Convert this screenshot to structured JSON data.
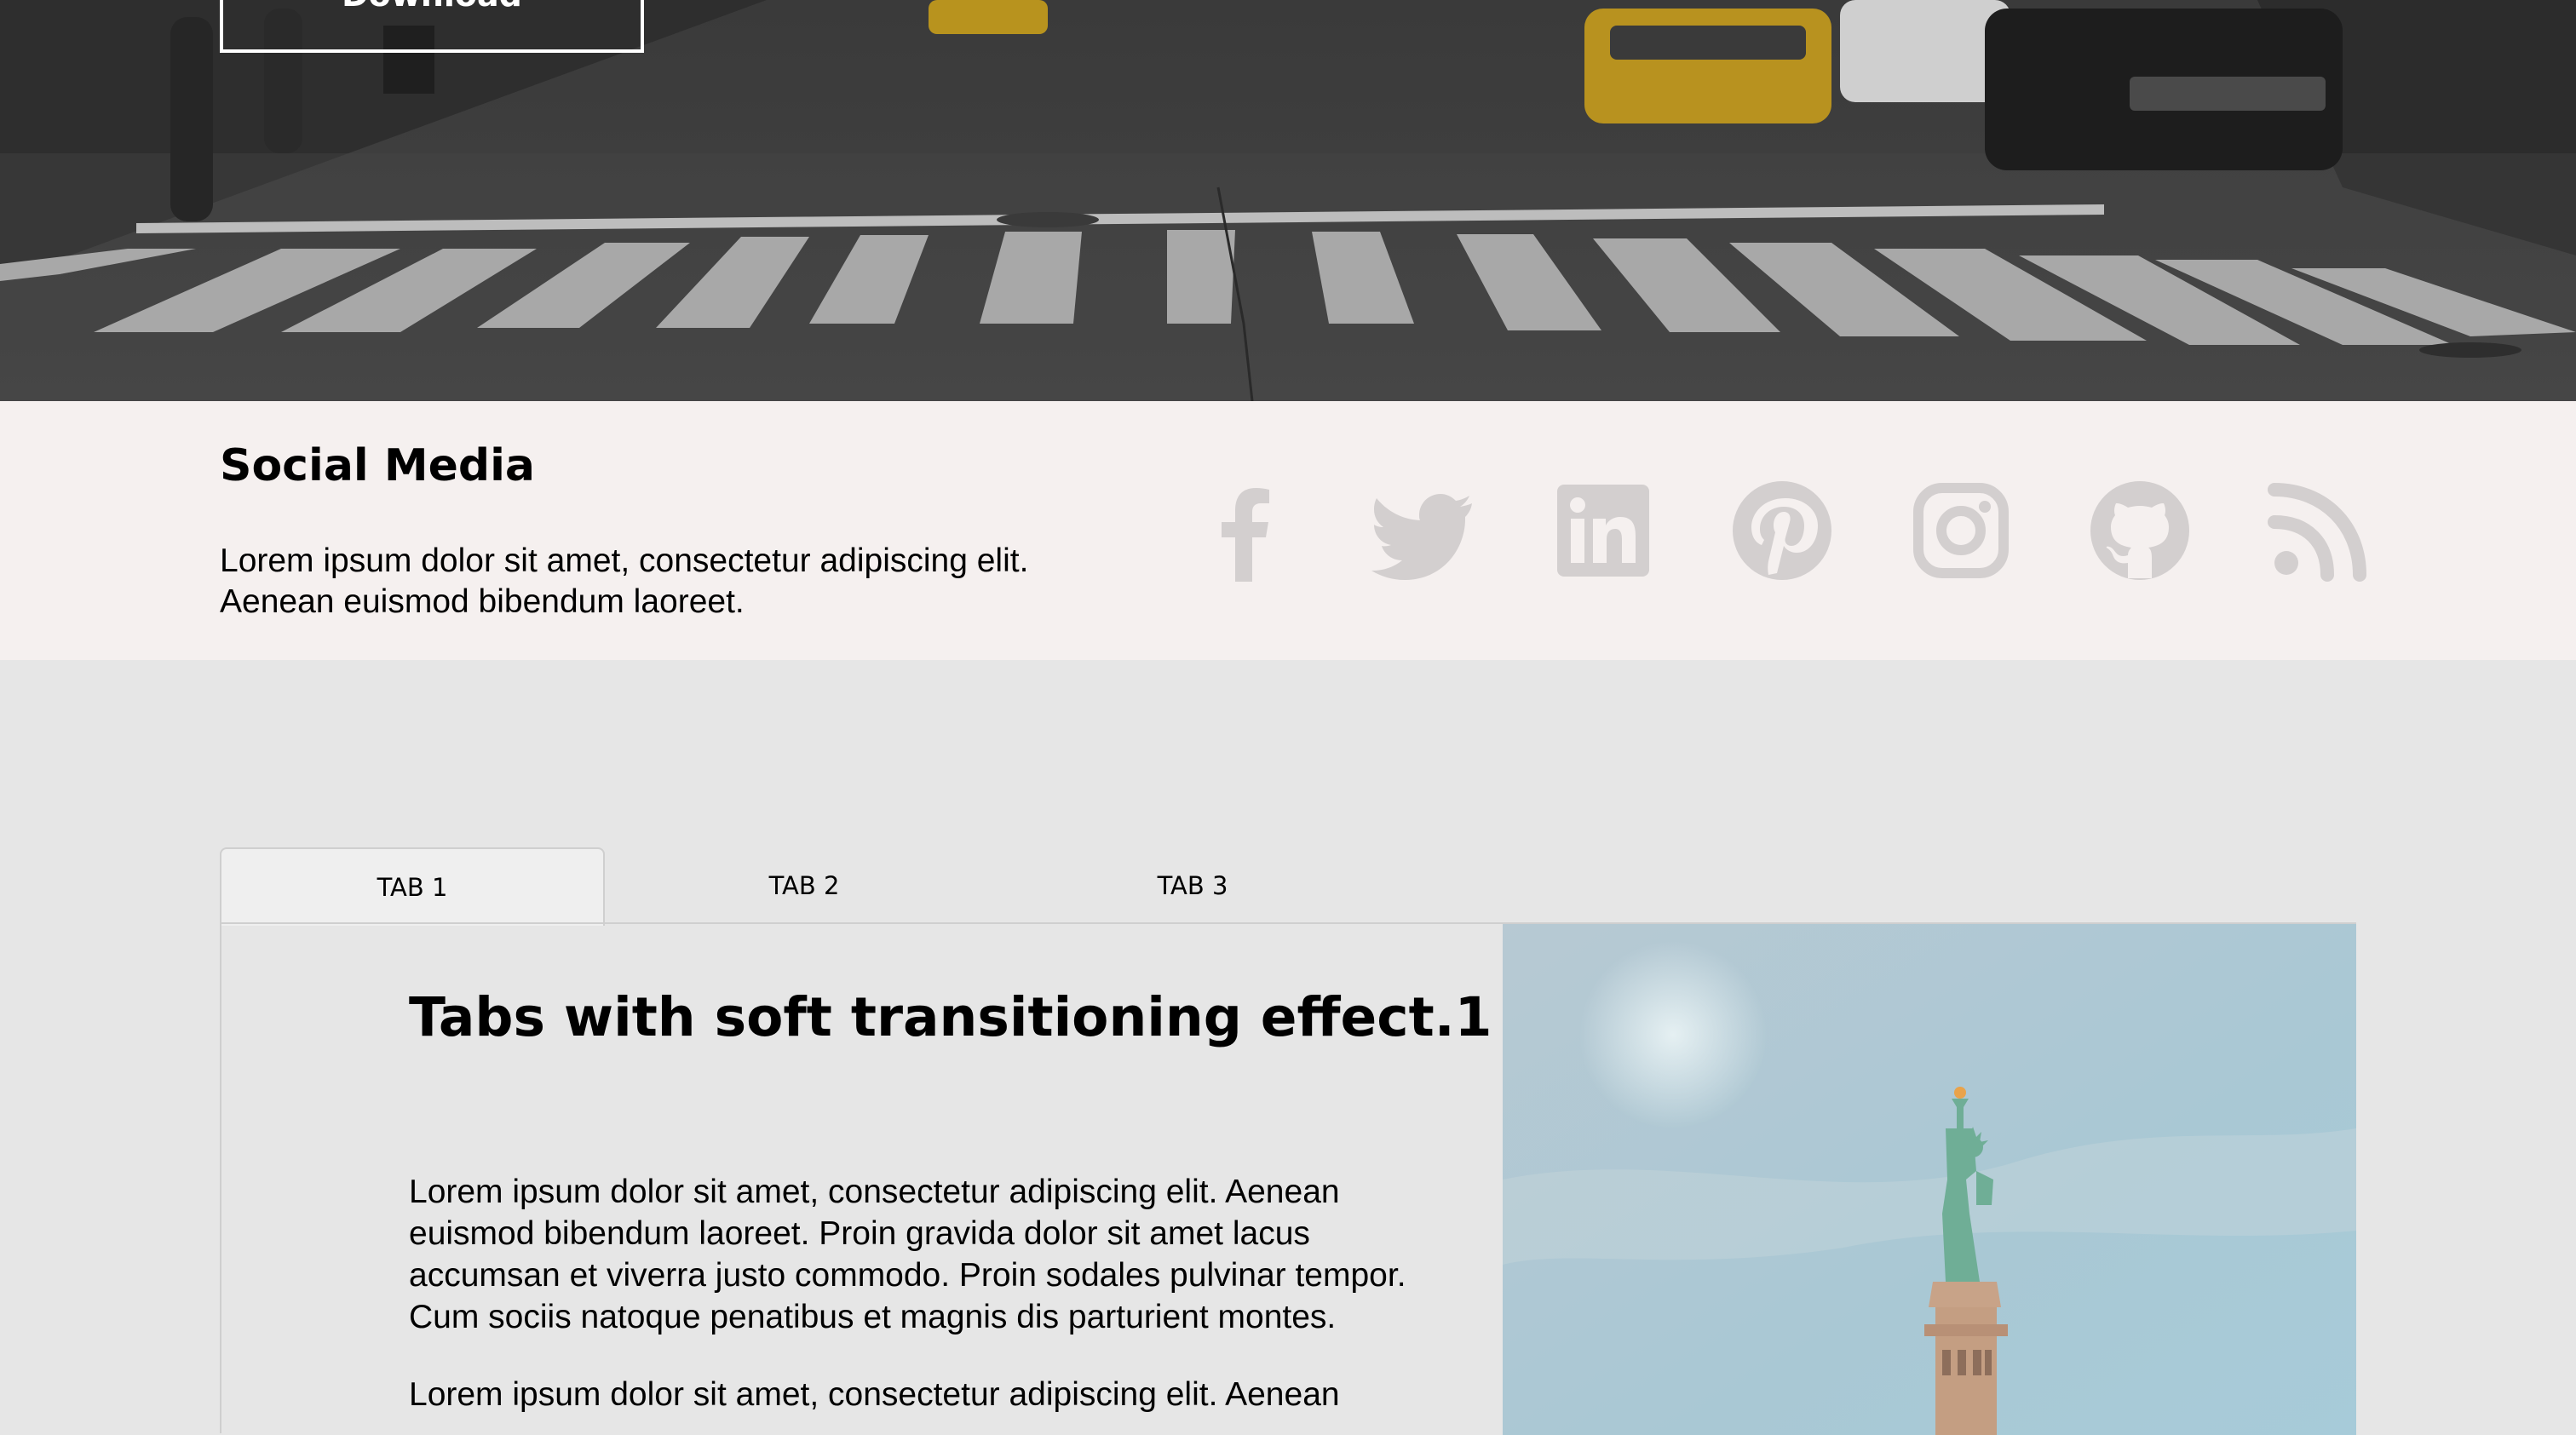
{
  "hero": {
    "download_label": "Download"
  },
  "social": {
    "title": "Social Media",
    "description": "Lorem ipsum dolor sit amet, consectetur adipiscing elit. Aenean euismod bibendum laoreet.",
    "icons": [
      "facebook-icon",
      "twitter-icon",
      "linkedin-icon",
      "pinterest-icon",
      "instagram-icon",
      "github-icon",
      "rss-icon"
    ],
    "icon_color": "#d3cfcf"
  },
  "tabs": {
    "items": [
      {
        "label": "TAB 1",
        "active": true
      },
      {
        "label": "TAB 2",
        "active": false
      },
      {
        "label": "TAB 3",
        "active": false
      }
    ]
  },
  "panel": {
    "heading": "Tabs with soft transitioning effect.1",
    "paragraph1": "Lorem ipsum dolor sit amet, consectetur adipiscing elit. Aenean euismod bibendum laoreet. Proin gravida dolor sit amet lacus accumsan et viverra justo commodo. Proin sodales pulvinar tempor. Cum sociis natoque penatibus et magnis dis parturient montes.",
    "paragraph2": "Lorem ipsum dolor sit amet, consectetur adipiscing elit. Aenean"
  }
}
